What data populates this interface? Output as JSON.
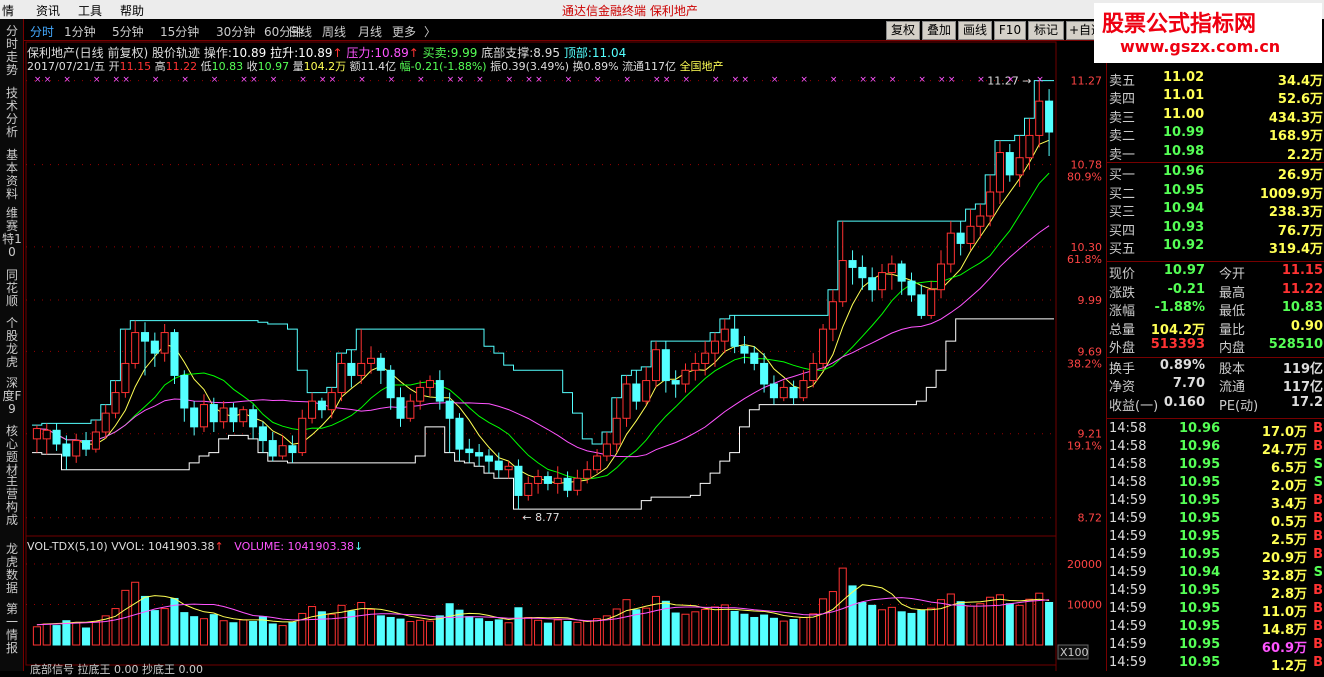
{
  "menu": {
    "items": [
      "情",
      "资讯",
      "工具",
      "帮助"
    ],
    "app_title": "通达信金融终端  保利地产"
  },
  "sidetabs": [
    "分时走势",
    "技术分析",
    "基本资料",
    "维赛特10",
    "同花顺",
    "个股龙虎",
    "深度F9",
    "核心题材",
    "主营构成",
    "龙虎数据",
    "第一情报"
  ],
  "periods": [
    "分时",
    "1分钟",
    "5分钟",
    "15分钟",
    "30分钟",
    "60分钟",
    "日线",
    "周线",
    "月线",
    "更多",
    "〉"
  ],
  "toolbar": [
    "复权",
    "叠加",
    "画线",
    "F10",
    "标记",
    "+自选"
  ],
  "logo": {
    "title": "股票公式指标网",
    "url": "www.gszx.com.cn"
  },
  "info": {
    "name": "保利地产(日线 前复权) 股价轨迹",
    "op_label": "操作:",
    "op_val": "10.89",
    "pull_label": "拉升:",
    "pull_val": "10.89",
    "press_label": "压力:",
    "press_val": "10.89",
    "trade_label": "买卖:",
    "trade_val": "9.99",
    "bottom_label": "底部支撑:",
    "bottom_val": "8.95",
    "top_label": "顶部:",
    "top_val": "11.04",
    "date": "2017/07/21/五",
    "open_label": "开",
    "open_val": "11.15",
    "high_label": "高",
    "high_val": "11.22",
    "low_label": "低",
    "low_val": "10.83",
    "close_label": "收",
    "close_val": "10.97",
    "vol_label": "量",
    "vol_val": "104.2万",
    "amt": "额11.4亿",
    "chg": "幅-0.21(-1.88%)",
    "amp": "振0.39(3.49%)",
    "turn": "换0.89%",
    "float": "流通117亿",
    "index": "全国地产"
  },
  "vol_header": {
    "a": "VOL-TDX(5,10)",
    "b": "VVOL: 1041903.38",
    "c": "VOLUME: 1041903.38"
  },
  "bottom_text": "底部信号  拉底王  0.00  抄底王  0.00",
  "x100": "X100",
  "colors": {
    "up": "#ff3232",
    "down": "#54ffff",
    "ma_short": "#ffff54",
    "ma_mid": "#ff54ff",
    "ma_long": "#00ff00",
    "white": "#ffffff",
    "cyan": "#54ffff",
    "grid": "#700000"
  },
  "chart_data": {
    "type": "candlestick",
    "price_ticks": [
      {
        "v": 11.27,
        "pct": ""
      },
      {
        "v": 10.78,
        "pct": "80.9%"
      },
      {
        "v": 10.3,
        "pct": "61.8%"
      },
      {
        "v": 9.99,
        "pct": ""
      },
      {
        "v": 9.69,
        "pct": "38.2%"
      },
      {
        "v": 9.21,
        "pct": "19.1%"
      },
      {
        "v": 8.72,
        "pct": ""
      }
    ],
    "ylim": [
      8.66,
      11.32
    ],
    "vol_ticks": [
      20000,
      10000
    ],
    "vol_ylim": [
      0,
      21000
    ],
    "high_label": "11.27",
    "low_label": "8.77",
    "candles": [
      [
        9.18,
        9.24,
        9.1,
        9.26
      ],
      [
        9.18,
        9.23,
        9.09,
        9.27
      ],
      [
        9.23,
        9.15,
        9.11,
        9.27
      ],
      [
        9.15,
        9.08,
        9.0,
        9.2
      ],
      [
        9.08,
        9.17,
        9.04,
        9.21
      ],
      [
        9.17,
        9.12,
        9.08,
        9.22
      ],
      [
        9.12,
        9.22,
        9.1,
        9.29
      ],
      [
        9.22,
        9.33,
        9.18,
        9.38
      ],
      [
        9.33,
        9.45,
        9.3,
        9.52
      ],
      [
        9.45,
        9.62,
        9.42,
        9.82
      ],
      [
        9.62,
        9.8,
        9.59,
        9.87
      ],
      [
        9.8,
        9.75,
        9.55,
        9.86
      ],
      [
        9.75,
        9.68,
        9.6,
        9.8
      ],
      [
        9.68,
        9.8,
        9.63,
        9.85
      ],
      [
        9.8,
        9.55,
        9.5,
        9.82
      ],
      [
        9.55,
        9.36,
        9.28,
        9.58
      ],
      [
        9.36,
        9.25,
        9.2,
        9.4
      ],
      [
        9.25,
        9.38,
        9.22,
        9.44
      ],
      [
        9.38,
        9.28,
        9.22,
        9.42
      ],
      [
        9.28,
        9.36,
        9.24,
        9.4
      ],
      [
        9.36,
        9.28,
        9.22,
        9.39
      ],
      [
        9.28,
        9.35,
        9.25,
        9.37
      ],
      [
        9.35,
        9.25,
        9.18,
        9.38
      ],
      [
        9.25,
        9.17,
        9.1,
        9.28
      ],
      [
        9.17,
        9.08,
        9.05,
        9.22
      ],
      [
        9.08,
        9.14,
        9.06,
        9.2
      ],
      [
        9.14,
        9.1,
        9.04,
        9.2
      ],
      [
        9.1,
        9.3,
        9.08,
        9.35
      ],
      [
        9.3,
        9.4,
        9.27,
        9.45
      ],
      [
        9.4,
        9.35,
        9.3,
        9.42
      ],
      [
        9.35,
        9.45,
        9.3,
        9.48
      ],
      [
        9.45,
        9.62,
        9.4,
        9.68
      ],
      [
        9.62,
        9.55,
        9.48,
        9.7
      ],
      [
        9.55,
        9.62,
        9.5,
        9.82
      ],
      [
        9.62,
        9.65,
        9.56,
        9.72
      ],
      [
        9.65,
        9.58,
        9.5,
        9.68
      ],
      [
        9.58,
        9.42,
        9.35,
        9.61
      ],
      [
        9.42,
        9.3,
        9.25,
        9.48
      ],
      [
        9.3,
        9.4,
        9.28,
        9.44
      ],
      [
        9.4,
        9.48,
        9.35,
        9.52
      ],
      [
        9.48,
        9.52,
        9.43,
        9.55
      ],
      [
        9.52,
        9.4,
        9.35,
        9.58
      ],
      [
        9.4,
        9.3,
        9.1,
        9.45
      ],
      [
        9.3,
        9.12,
        9.05,
        9.33
      ],
      [
        9.12,
        9.1,
        9.04,
        9.18
      ],
      [
        9.1,
        9.08,
        9.02,
        9.15
      ],
      [
        9.08,
        9.05,
        8.98,
        9.12
      ],
      [
        9.05,
        9.0,
        8.95,
        9.1
      ],
      [
        9.0,
        9.02,
        8.95,
        9.05
      ],
      [
        9.02,
        8.85,
        8.77,
        9.06
      ],
      [
        8.85,
        8.92,
        8.82,
        8.96
      ],
      [
        8.92,
        8.96,
        8.86,
        9.0
      ],
      [
        8.96,
        8.92,
        8.88,
        8.99
      ],
      [
        8.92,
        8.95,
        8.86,
        9.02
      ],
      [
        8.95,
        8.88,
        8.84,
        8.99
      ],
      [
        8.88,
        8.95,
        8.85,
        9.0
      ],
      [
        8.95,
        9.0,
        8.92,
        9.05
      ],
      [
        9.0,
        9.08,
        8.98,
        9.12
      ],
      [
        9.08,
        9.15,
        9.05,
        9.22
      ],
      [
        9.15,
        9.3,
        9.1,
        9.42
      ],
      [
        9.3,
        9.5,
        9.25,
        9.55
      ],
      [
        9.5,
        9.4,
        9.35,
        9.58
      ],
      [
        9.4,
        9.52,
        9.38,
        9.6
      ],
      [
        9.52,
        9.7,
        9.48,
        9.75
      ],
      [
        9.7,
        9.52,
        9.45,
        9.75
      ],
      [
        9.52,
        9.5,
        9.42,
        9.58
      ],
      [
        9.5,
        9.58,
        9.45,
        9.62
      ],
      [
        9.58,
        9.62,
        9.52,
        9.68
      ],
      [
        9.62,
        9.68,
        9.55,
        9.75
      ],
      [
        9.68,
        9.75,
        9.6,
        9.8
      ],
      [
        9.75,
        9.82,
        9.68,
        9.88
      ],
      [
        9.82,
        9.72,
        9.68,
        9.9
      ],
      [
        9.72,
        9.68,
        9.62,
        9.78
      ],
      [
        9.68,
        9.62,
        9.58,
        9.72
      ],
      [
        9.62,
        9.5,
        9.45,
        9.68
      ],
      [
        9.5,
        9.42,
        9.38,
        9.55
      ],
      [
        9.42,
        9.48,
        9.4,
        9.52
      ],
      [
        9.48,
        9.42,
        9.38,
        9.52
      ],
      [
        9.42,
        9.52,
        9.4,
        9.58
      ],
      [
        9.52,
        9.62,
        9.48,
        9.68
      ],
      [
        9.62,
        9.82,
        9.58,
        9.85
      ],
      [
        9.82,
        9.98,
        9.75,
        10.05
      ],
      [
        9.98,
        10.22,
        9.95,
        10.45
      ],
      [
        10.22,
        10.18,
        10.08,
        10.28
      ],
      [
        10.18,
        10.12,
        10.05,
        10.25
      ],
      [
        10.12,
        10.05,
        9.98,
        10.18
      ],
      [
        10.05,
        10.15,
        10.0,
        10.2
      ],
      [
        10.15,
        10.2,
        10.05,
        10.25
      ],
      [
        10.2,
        10.1,
        10.02,
        10.22
      ],
      [
        10.1,
        10.02,
        9.98,
        10.15
      ],
      [
        10.02,
        9.9,
        9.88,
        10.08
      ],
      [
        9.9,
        10.05,
        9.88,
        10.1
      ],
      [
        10.05,
        10.2,
        10.0,
        10.28
      ],
      [
        10.2,
        10.38,
        10.15,
        10.45
      ],
      [
        10.38,
        10.32,
        10.25,
        10.45
      ],
      [
        10.32,
        10.42,
        10.28,
        10.52
      ],
      [
        10.42,
        10.48,
        10.35,
        10.55
      ],
      [
        10.48,
        10.62,
        10.42,
        10.72
      ],
      [
        10.62,
        10.85,
        10.55,
        10.92
      ],
      [
        10.85,
        10.72,
        10.68,
        10.9
      ],
      [
        10.72,
        10.82,
        10.65,
        10.95
      ],
      [
        10.82,
        10.95,
        10.75,
        11.05
      ],
      [
        10.95,
        11.15,
        10.88,
        11.27
      ],
      [
        11.15,
        10.97,
        10.83,
        11.22
      ]
    ],
    "volumes": [
      4500,
      5200,
      4800,
      6000,
      5500,
      4200,
      5800,
      7200,
      9000,
      13500,
      15500,
      12000,
      8500,
      9000,
      11500,
      8000,
      7000,
      6500,
      7500,
      6000,
      5500,
      6200,
      5800,
      7000,
      5200,
      4800,
      5600,
      7800,
      9500,
      8200,
      7600,
      9800,
      8400,
      10500,
      8800,
      7200,
      6800,
      6400,
      5800,
      6100,
      5900,
      7200,
      10200,
      8600,
      7000,
      6500,
      5800,
      6200,
      5500,
      9200,
      6800,
      6100,
      5400,
      6200,
      5800,
      5600,
      5900,
      6500,
      7200,
      8900,
      11200,
      8700,
      9100,
      12000,
      10800,
      7900,
      7600,
      8200,
      8800,
      9400,
      9900,
      8300,
      7600,
      6800,
      7400,
      6600,
      5900,
      6300,
      6800,
      7700,
      11400,
      13200,
      19000,
      14600,
      10500,
      9800,
      8700,
      9300,
      8200,
      7800,
      8600,
      9100,
      11200,
      12600,
      10700,
      9600,
      10200,
      11800,
      12400,
      10200,
      9800,
      11300,
      12800,
      10500
    ],
    "volumes_down": [
      false,
      false,
      true,
      true,
      false,
      true,
      false,
      false,
      false,
      false,
      false,
      true,
      true,
      false,
      true,
      true,
      true,
      false,
      true,
      false,
      true,
      false,
      true,
      true,
      true,
      false,
      true,
      false,
      false,
      true,
      false,
      false,
      true,
      false,
      false,
      true,
      true,
      true,
      false,
      false,
      false,
      true,
      true,
      true,
      true,
      true,
      true,
      true,
      false,
      true,
      false,
      false,
      true,
      false,
      true,
      false,
      false,
      false,
      false,
      false,
      false,
      true,
      false,
      false,
      true,
      true,
      false,
      false,
      false,
      false,
      false,
      true,
      true,
      true,
      true,
      true,
      false,
      true,
      false,
      false,
      false,
      false,
      false,
      true,
      true,
      true,
      false,
      false,
      true,
      true,
      true,
      false,
      false,
      false,
      true,
      false,
      false,
      false,
      false,
      true,
      false,
      false,
      false,
      true
    ],
    "ma5_vol": [
      5000,
      5200,
      5300,
      5400,
      5600,
      5600,
      5900,
      6400,
      7100,
      8800,
      10300,
      11800,
      12200,
      12000,
      11500,
      10000,
      9000,
      8200,
      7900,
      7000,
      6500,
      6200,
      6200,
      6200,
      5900,
      5700,
      5700,
      6300,
      7000,
      7400,
      7800,
      8100,
      8600,
      9000,
      9000,
      8800,
      8300,
      7700,
      7100,
      6700,
      6300,
      6500,
      7100,
      7600,
      7800,
      7700,
      7300,
      6700,
      6300,
      6600,
      6700,
      6800,
      6700,
      6800,
      6700,
      6200,
      5800,
      6000,
      6400,
      7300,
      8500,
      9000,
      9600,
      10100,
      10400,
      9900,
      9800,
      9700,
      9100,
      8700,
      8800,
      8800,
      8600,
      8400,
      8300,
      7900,
      7300,
      7000,
      6800,
      6900,
      7700,
      8800,
      11000,
      13100,
      14900,
      14600,
      14100,
      12600,
      10100,
      9000,
      8700,
      8700,
      9000,
      9800,
      10500,
      10600,
      10700,
      11000,
      11300,
      11000,
      10900,
      11100,
      11300,
      11000
    ],
    "ma10_vol": [
      5000,
      5100,
      5200,
      5300,
      5400,
      5500,
      5600,
      5800,
      6200,
      6800,
      7500,
      8200,
      8900,
      9400,
      9800,
      10000,
      10100,
      10000,
      10000,
      9500,
      8800,
      8000,
      7300,
      7100,
      6800,
      6400,
      6200,
      6200,
      6300,
      6400,
      6500,
      6700,
      7000,
      7300,
      7600,
      7700,
      7700,
      7600,
      7500,
      7400,
      7100,
      6900,
      6800,
      6900,
      7000,
      7000,
      6900,
      6800,
      6600,
      6600,
      6600,
      6600,
      6500,
      6400,
      6400,
      6200,
      6000,
      6000,
      6200,
      6500,
      7000,
      7500,
      7900,
      8500,
      9000,
      9300,
      9400,
      9400,
      9300,
      9300,
      9200,
      9200,
      9000,
      8700,
      8500,
      8300,
      8100,
      7800,
      7500,
      7400,
      7700,
      8200,
      9000,
      9900,
      10700,
      11200,
      11400,
      11600,
      11700,
      11500,
      11100,
      10600,
      10300,
      9900,
      9800,
      9600,
      9600,
      9700,
      9800,
      10200,
      10500,
      10800,
      11000,
      11200
    ]
  }
}
